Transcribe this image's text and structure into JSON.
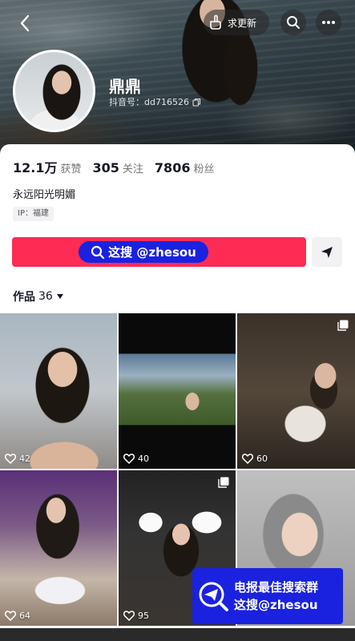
{
  "header": {
    "update_label": "求更新"
  },
  "profile": {
    "name": "鼎鼎",
    "douyin_id": "抖音号：dd716526"
  },
  "stats": [
    {
      "value": "12.1万",
      "label": "获赞"
    },
    {
      "value": "305",
      "label": "关注"
    },
    {
      "value": "7806",
      "label": "粉丝"
    }
  ],
  "bio": "永远阳光明媚",
  "ip": "IP：福建",
  "search_banner": {
    "text": "这搜 @zhesou"
  },
  "works_tab": {
    "label": "作品",
    "count": "36"
  },
  "tiles": [
    {
      "likes": "42",
      "multi": false
    },
    {
      "likes": "40",
      "multi": false
    },
    {
      "likes": "60",
      "multi": true
    },
    {
      "likes": "64",
      "multi": false
    },
    {
      "likes": "95",
      "multi": true
    },
    {
      "likes": "",
      "multi": false
    }
  ],
  "ad": {
    "line1": "电报最佳搜索群",
    "line2": "这搜@zhesou"
  },
  "colors": {
    "accent": "#fe2c55",
    "overlay_blue": "#1a22e0"
  }
}
